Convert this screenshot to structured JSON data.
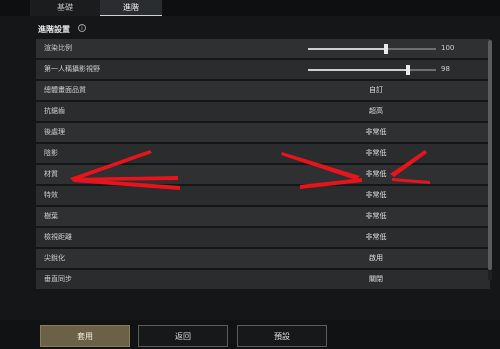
{
  "tabs": [
    "基礎",
    "進階"
  ],
  "section_title": "進階設置",
  "info_icon": "i",
  "rows": [
    {
      "label": "渲染比例",
      "type": "slider",
      "fill": 0.6,
      "value": "100"
    },
    {
      "label": "第一人稱攝影視野",
      "type": "slider",
      "fill": 0.78,
      "value": "98"
    },
    {
      "label": "總體畫面品質",
      "type": "text",
      "value": "自訂"
    },
    {
      "label": "抗鋸齒",
      "type": "text",
      "value": "超高"
    },
    {
      "label": "後處理",
      "type": "text",
      "value": "非常低"
    },
    {
      "label": "陰影",
      "type": "text",
      "value": "非常低"
    },
    {
      "label": "材質",
      "type": "text",
      "value": "非常低"
    },
    {
      "label": "特效",
      "type": "text",
      "value": "非常低"
    },
    {
      "label": "樹葉",
      "type": "text",
      "value": "非常低"
    },
    {
      "label": "檢視距離",
      "type": "text",
      "value": "非常低"
    },
    {
      "label": "尖銳化",
      "type": "text",
      "value": "啟用"
    },
    {
      "label": "垂直同步",
      "type": "text",
      "value": "關閉"
    }
  ],
  "buttons": {
    "apply": "套用",
    "back": "返回",
    "preset": "預設"
  },
  "colors": {
    "annotation": "#e8141c",
    "apply_bg": "#6b6048"
  }
}
